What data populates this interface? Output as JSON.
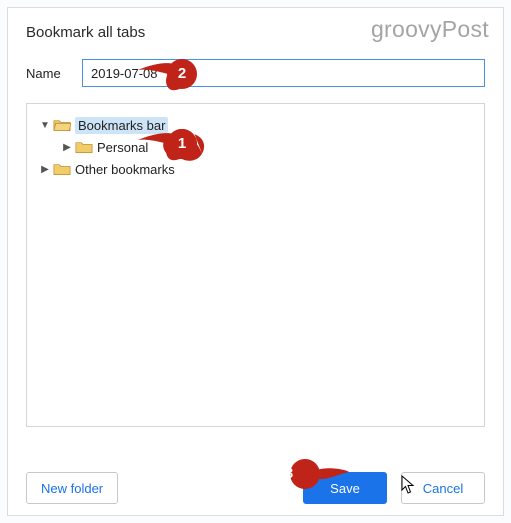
{
  "watermark": "groovyPost",
  "dialog": {
    "title": "Bookmark all tabs",
    "name_label": "Name",
    "name_value": "2019-07-08"
  },
  "tree": {
    "items": [
      {
        "label": "Bookmarks bar",
        "expanded": true,
        "selected": true
      },
      {
        "label": "Personal",
        "expanded": false,
        "selected": false
      },
      {
        "label": "Other bookmarks",
        "expanded": false,
        "selected": false
      }
    ]
  },
  "footer": {
    "new_folder": "New folder",
    "save": "Save",
    "cancel": "Cancel"
  },
  "callouts": {
    "c1": "1",
    "c2": "2",
    "c3": "3"
  }
}
